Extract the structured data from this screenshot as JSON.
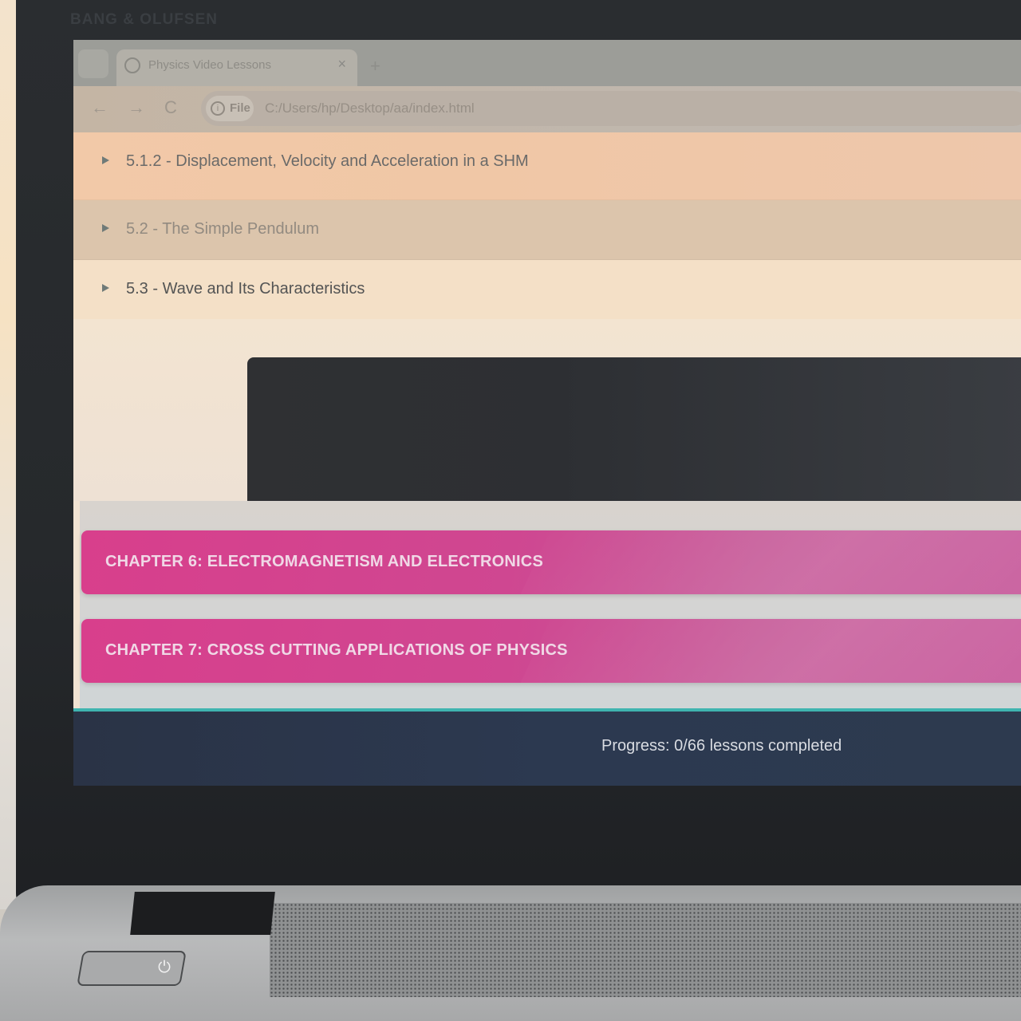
{
  "device": {
    "brand": "BANG & OLUFSEN",
    "power_icon": "power-icon"
  },
  "browser": {
    "tab_title": "Physics Video Lessons",
    "tab_close": "×",
    "new_tab": "+",
    "nav": {
      "back": "←",
      "forward": "→",
      "reload": "C"
    },
    "chip_label": "File",
    "url": "C:/Users/hp/Desktop/aa/index.html"
  },
  "lessons": [
    {
      "label": "5.1.2 - Displacement, Velocity and Acceleration in a SHM"
    },
    {
      "label": "5.2 - The Simple Pendulum"
    },
    {
      "label": "5.3 - Wave and Its Characteristics"
    }
  ],
  "chapters": [
    {
      "title": "CHAPTER 6: ELECTROMAGNETISM AND ELECTRONICS"
    },
    {
      "title": "CHAPTER 7: CROSS CUTTING APPLICATIONS OF PHYSICS"
    }
  ],
  "footer": {
    "progress": "Progress: 0/66 lessons completed"
  },
  "colors": {
    "chapter_accent": "#d83f8c",
    "footer_bg": "#2c3950",
    "footer_border": "#3fb4b0"
  }
}
